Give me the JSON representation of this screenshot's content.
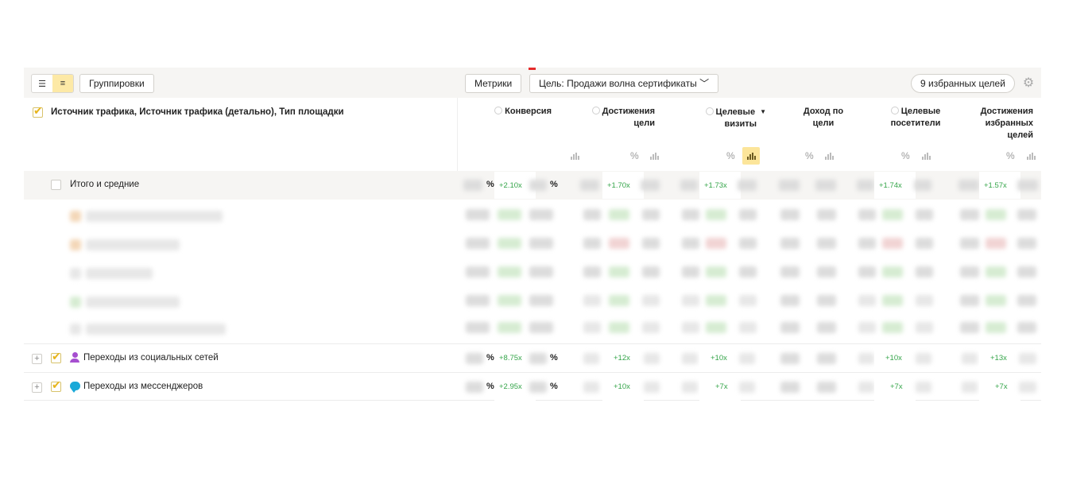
{
  "toolbar": {
    "view_list_icon": "list-icon",
    "view_tree_icon": "tree-icon",
    "groupings_label": "Группировки",
    "metrics_label": "Метрики",
    "goal_label": "Цель: Продажи волна сертификаты",
    "favorites_label": "9 избранных целей",
    "gear_icon": "gear-icon"
  },
  "table": {
    "dimension_header": "Источник трафика, Источник трафика (детально), Тип площадки",
    "columns": [
      {
        "label_1": "Конверсия",
        "label_2": ""
      },
      {
        "label_1": "Достижения",
        "label_2": "цели"
      },
      {
        "label_1": "Целевые",
        "label_2": "визиты",
        "sorted": true
      },
      {
        "label_1": "Доход по",
        "label_2": "цели"
      },
      {
        "label_1": "Целевые",
        "label_2": "посетители"
      },
      {
        "label_1": "Достижения",
        "label_2": "избранных",
        "label_3": "целей"
      }
    ],
    "pct_symbol": "%",
    "total_row": {
      "label": "Итого и средние",
      "values": [
        "+2.10x",
        "+1.70x",
        "+1.73x",
        "+1.74x",
        "+1.57x"
      ]
    },
    "social_row": {
      "label": "Переходы из социальных сетей",
      "values": [
        "+8.75x",
        "+12x",
        "+10x",
        "+10x",
        "+13x"
      ]
    },
    "messengers_row": {
      "label": "Переходы из мессенджеров",
      "values": [
        "+2.95x",
        "+10x",
        "+7x",
        "+7x",
        "+7x"
      ]
    }
  },
  "colors": {
    "accent_yellow": "#fce59a",
    "positive_green": "#35a54a",
    "social_purple": "#a64fd0",
    "messenger_blue": "#1aa9d8"
  }
}
